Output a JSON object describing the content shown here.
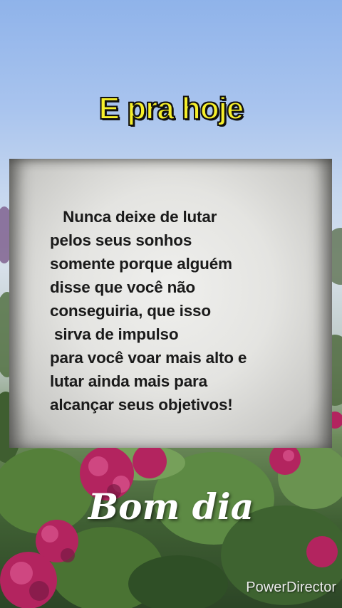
{
  "headline": "E pra hoje",
  "quote": "   Nunca deixe de lutar\npelos seus sonhos\nsomente porque alguém\ndisse que você não\nconseguiria, que isso\n sirva de impulso\npara você voar mais alto e\nlutar ainda mais para\nalcançar seus objetivos!",
  "greeting": "Bom dia",
  "watermark": "PowerDirector",
  "colors": {
    "headline": "#f6ef2a",
    "card": "#e4e4e1",
    "flowers": "#b3245f",
    "leaves": "#4f7a35"
  }
}
